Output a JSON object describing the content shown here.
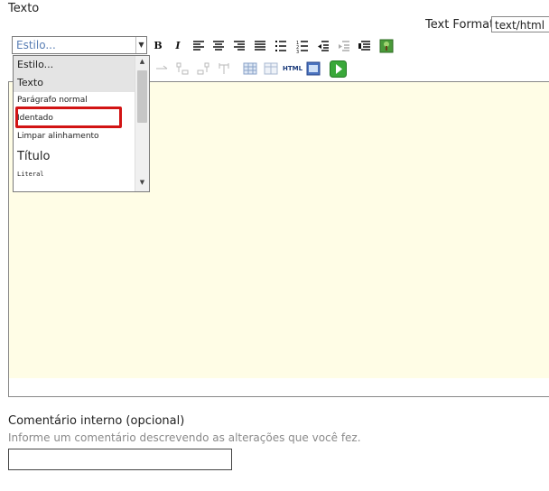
{
  "field": {
    "label": "Texto"
  },
  "format": {
    "label": "Text Format",
    "value": "text/html"
  },
  "toolbar": {
    "style_combo_value": "Estilo...",
    "buttons": [
      "bold",
      "italic",
      "align-left",
      "align-center",
      "align-right",
      "align-justify",
      "bulleted-list",
      "numbered-list",
      "outdent",
      "indent",
      "image"
    ],
    "html_label": "HTML"
  },
  "dropdown": {
    "header1": "Estilo...",
    "header2": "Texto",
    "items": [
      {
        "label": "Parágrafo normal"
      },
      {
        "label": "Identado"
      },
      {
        "label": "Limpar alinhamento"
      },
      {
        "label": "Título"
      },
      {
        "label": "Literal"
      }
    ]
  },
  "comment": {
    "label": "Comentário interno (opcional)",
    "help": "Informe um comentário descrevendo as alterações que você fez.",
    "value": ""
  },
  "colors": {
    "editor_bg": "#fffde6",
    "highlight": "#d21414"
  }
}
